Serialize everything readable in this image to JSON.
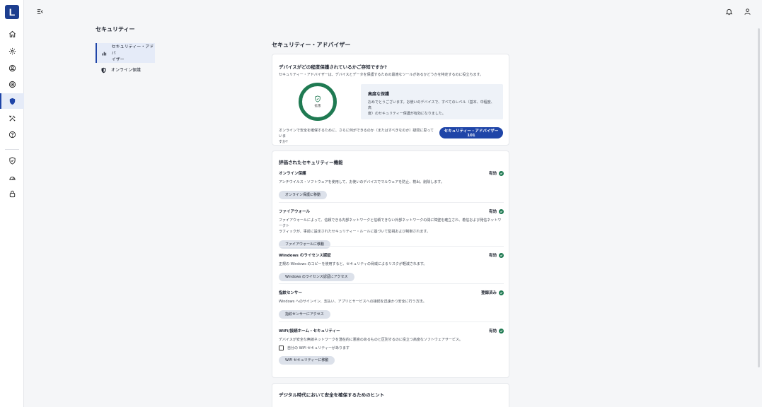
{
  "app": {
    "logo_letter": "L",
    "brand_color": "#1d3e8f",
    "accent_color": "#1f45a8",
    "ok_color": "#1f7a52"
  },
  "rail": {
    "icons": [
      "home-icon",
      "gear-icon",
      "account-icon",
      "target-icon",
      "shield-icon",
      "tools-icon",
      "help-icon",
      "shield-check-icon",
      "speed-icon",
      "lock-icon"
    ],
    "active": "shield-icon"
  },
  "topbar": {
    "icons": [
      "collapse-menu-icon",
      "bell-icon",
      "user-icon"
    ]
  },
  "section": {
    "title": "セキュリティー",
    "nav": [
      {
        "label_line1": "セキュリティー・アドバ",
        "label_line2": "イザー",
        "icon": "bar-chart-icon",
        "active": true
      },
      {
        "label_line1": "オンライン保護",
        "label_line2": "",
        "icon": "shield-half-icon",
        "active": false
      }
    ]
  },
  "main": {
    "page_title": "セキュリティー・アドバイザー",
    "overview": {
      "heading": "デバイスがどの程度保護されているかご存知ですか?",
      "description": "セキュリティー・アドバイザーは、デバイスとデータを保護するための最適なツールがあるかどうかを特定するのに役立ちます。",
      "ring_label": "拡張",
      "level_title": "高度な保護",
      "level_desc_1": "おめでとうございます。お使いのデバイスで、すべてのレベル（基本、中程度、高",
      "level_desc_2": "度）のセキュリティー保護が有効になりました。",
      "footer_text_1": "オンラインで安全を確保するために、さらに何ができるのか（またはすべきなのか）疑問に思っていま",
      "footer_text_2": "すか?",
      "cta_label": "セキュリティー・アドバイザー 101"
    },
    "features": {
      "heading": "評価されたセキュリティー機能",
      "items": [
        {
          "name": "オンライン保護",
          "status": "有効",
          "desc_1": "アンチウイルス・ソフトウェアを使用して、お使いのデバイスでマルウェアを防止、検出、削除します。",
          "desc_2": "",
          "action": "オンライン保護に移動"
        },
        {
          "name": "ファイアウォール",
          "status": "有効",
          "desc_1": "ファイアウォールによって、信頼できる内部ネットワークと信頼できない外部ネットワークの間に障壁を確立され、着信および発信ネットワークト",
          "desc_2": "ラフィックが、事前に設定されたセキュリティー・ルールに基づいて監視および制御されます。",
          "action": "ファイアウォールに移動"
        },
        {
          "name": "Windows のライセンス認証",
          "status": "有効",
          "desc_1": "正規の Windows のコピーを使用すると、セキュリティの脅威によるリスクが軽減されます。",
          "desc_2": "",
          "action": "Windows のライセンス認証にアクセス"
        },
        {
          "name": "指紋センサー",
          "status": "登録済み",
          "desc_1": "Windows へのサインイン、支払い、アプリとサービスへの接続を迅速かつ安全に行う方法。",
          "desc_2": "",
          "action": "指紋センサーにアクセス"
        },
        {
          "name": "WiFi/接続ホーム・セキュリティー",
          "status": "有効",
          "desc_1": "デバイスが安全な無線ネットワークを潜在的に悪意のあるものと区別するのに役立つ高度なソフトウェアサービス。",
          "desc_2": "",
          "checkbox_label": "自分の WiFi セキュリティーがあります",
          "action": "WiFi セキュリティーに移動"
        }
      ]
    },
    "tips": {
      "heading": "デジタル時代において安全を確保するためのヒント"
    }
  }
}
